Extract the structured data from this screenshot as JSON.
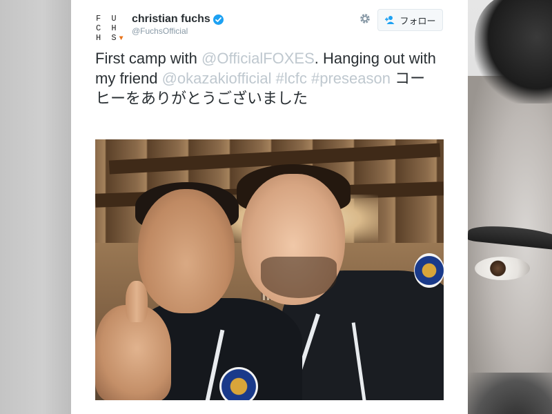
{
  "profile": {
    "logo_line1": "F U C H",
    "logo_line2": "H S",
    "display_name": "christian fuchs",
    "handle": "@FuchsOfficial",
    "verified": true
  },
  "actions": {
    "settings_icon": "gear-icon",
    "follow_label": "フォロー",
    "follow_icon": "person-plus-icon"
  },
  "tweet": {
    "text_parts": [
      {
        "text": "First camp with ",
        "type": "text"
      },
      {
        "text": "@OfficialFOXES",
        "type": "link"
      },
      {
        "text": ". Hanging out with my friend ",
        "type": "text"
      },
      {
        "text": "@okazakiofficial",
        "type": "link"
      },
      {
        "text": " ",
        "type": "text"
      },
      {
        "text": "#lcfc",
        "type": "link"
      },
      {
        "text": " ",
        "type": "text"
      },
      {
        "text": "#preseason",
        "type": "link"
      },
      {
        "text": " コーヒーをありがとうございました",
        "type": "text"
      }
    ]
  },
  "colors": {
    "link": "#bfc8cf",
    "text": "#292f33",
    "muted": "#8899a6",
    "verified": "#1da1f2",
    "logo_accent": "#e8731a"
  }
}
